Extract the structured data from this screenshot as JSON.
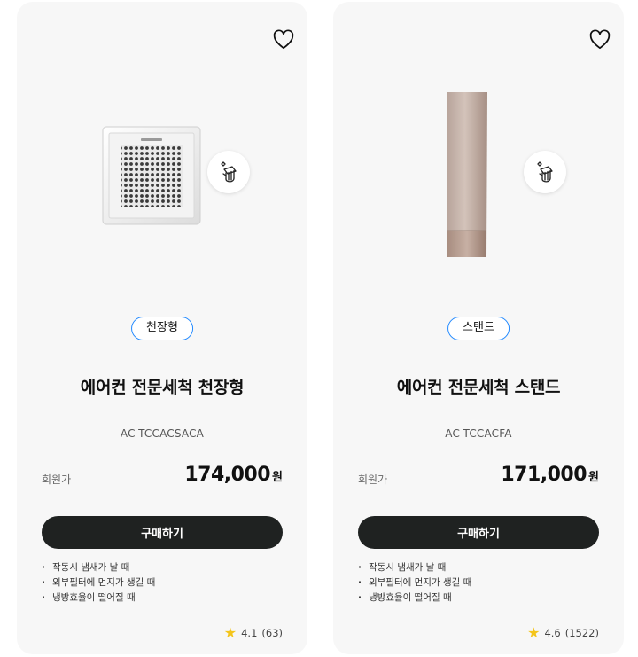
{
  "products": [
    {
      "category": "천장형",
      "title": "에어컨 전문세척 천장형",
      "model": "AC-TCCACSACA",
      "price_label": "회원가",
      "price": "174,000",
      "price_unit": "원",
      "buy_label": "구매하기",
      "bullets": [
        "작동시 냄새가 날 때",
        "외부필터에 먼지가 생길 때",
        "냉방효율이 떨어질 때"
      ],
      "rating": "4.1",
      "review_count": "(63)"
    },
    {
      "category": "스탠드",
      "title": "에어컨 전문세척 스탠드",
      "model": "AC-TCCACFA",
      "price_label": "회원가",
      "price": "171,000",
      "price_unit": "원",
      "buy_label": "구매하기",
      "bullets": [
        "작동시 냄새가 날 때",
        "외부필터에 먼지가 생길 때",
        "냉방효율이 떨어질 때"
      ],
      "rating": "4.6",
      "review_count": "(1522)"
    }
  ],
  "icons": {
    "wishlist": "heart-outline-icon",
    "cleaning": "cleaning-hand-icon",
    "rating": "star-icon"
  },
  "colors": {
    "card_bg": "#f7f7f7",
    "badge_border": "#2189ff",
    "button_bg": "#1f2221",
    "star": "#f4c51b"
  }
}
